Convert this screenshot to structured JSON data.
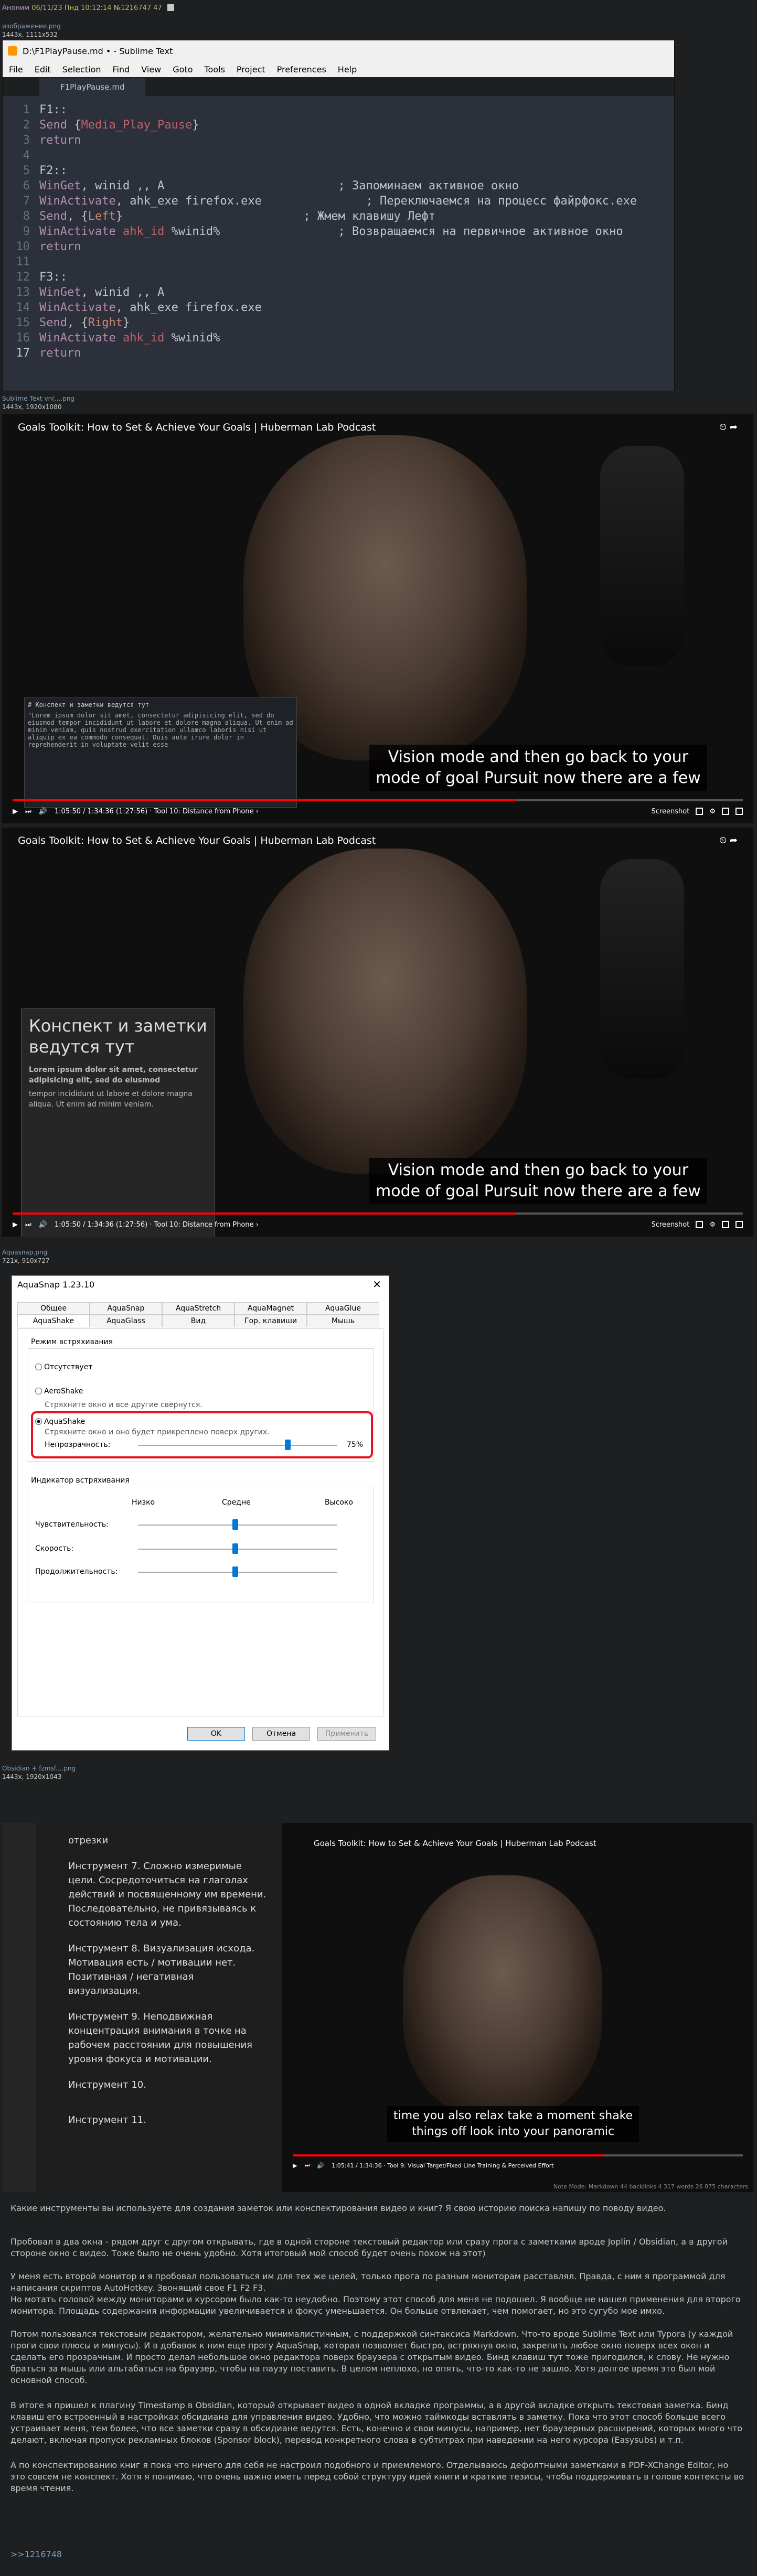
{
  "post": {
    "name": "Аноним",
    "date": "06/11/23 Пнд 10:12:14",
    "num": "№1216747",
    "count": "47"
  },
  "file1": {
    "name": "изображение.png",
    "size": "1443x, 1111x532"
  },
  "sublime": {
    "title": "D:\\F1PlayPause.md • - Sublime Text",
    "menu": [
      "File",
      "Edit",
      "Selection",
      "Find",
      "View",
      "Goto",
      "Tools",
      "Project",
      "Preferences",
      "Help"
    ],
    "tab": "F1PlayPause.md",
    "lines": [
      {
        "n": "1",
        "t": [
          [
            "c-lbl",
            "F1::"
          ]
        ]
      },
      {
        "n": "2",
        "t": [
          [
            "c-kw",
            "Send "
          ],
          [
            "c-pl",
            "{"
          ],
          [
            "c-vr",
            "Media_Play_Pause"
          ],
          [
            "c-pl",
            "}"
          ]
        ]
      },
      {
        "n": "3",
        "t": [
          [
            "c-kw",
            "return"
          ]
        ]
      },
      {
        "n": "4",
        "t": []
      },
      {
        "n": "5",
        "t": [
          [
            "c-lbl",
            "F2::"
          ]
        ]
      },
      {
        "n": "6",
        "t": [
          [
            "c-kw",
            "WinGet"
          ],
          [
            "c-pl",
            ", winid ,, A                         ; Запоминаем активное окно"
          ]
        ]
      },
      {
        "n": "7",
        "t": [
          [
            "c-kw",
            "WinActivate"
          ],
          [
            "c-pl",
            ", ahk_exe firefox.exe               ; Переключаемся на процесс файрфокс.exe"
          ]
        ]
      },
      {
        "n": "8",
        "t": [
          [
            "c-kw",
            "Send"
          ],
          [
            "c-pl",
            ", {"
          ],
          [
            "c-str",
            "Left"
          ],
          [
            "c-pl",
            "}                          ; Жмем клавишу Лефт"
          ]
        ]
      },
      {
        "n": "9",
        "t": [
          [
            "c-kw",
            "WinActivate "
          ],
          [
            "c-vr",
            "ahk_id "
          ],
          [
            "c-pl",
            "%winid%                 ; Возвращаемся на первичное активное окно"
          ]
        ]
      },
      {
        "n": "10",
        "t": [
          [
            "c-kw",
            "return"
          ]
        ]
      },
      {
        "n": "11",
        "t": []
      },
      {
        "n": "12",
        "t": [
          [
            "c-lbl",
            "F3::"
          ]
        ]
      },
      {
        "n": "13",
        "t": [
          [
            "c-kw",
            "WinGet"
          ],
          [
            "c-pl",
            ", winid ,, A"
          ]
        ]
      },
      {
        "n": "14",
        "t": [
          [
            "c-kw",
            "WinActivate"
          ],
          [
            "c-pl",
            ", ahk_exe firefox.exe"
          ]
        ]
      },
      {
        "n": "15",
        "t": [
          [
            "c-kw",
            "Send"
          ],
          [
            "c-pl",
            ", {"
          ],
          [
            "c-str",
            "Right"
          ],
          [
            "c-pl",
            "}"
          ]
        ]
      },
      {
        "n": "16",
        "t": [
          [
            "c-kw",
            "WinActivate "
          ],
          [
            "c-vr",
            "ahk_id "
          ],
          [
            "c-pl",
            "%winid%"
          ]
        ]
      },
      {
        "n": "17",
        "t": [
          [
            "c-kw",
            "return"
          ]
        ]
      }
    ]
  },
  "file2": {
    "name": "Sublime Text vn(....png",
    "size": "1443x, 1920x1080"
  },
  "video": {
    "title": "Goals Toolkit: How to Set & Achieve Your Goals | Huberman Lab Podcast",
    "subs1": "Vision mode and then go back to your",
    "subs2": "mode of goal Pursuit now there are a few",
    "time": "1:05:50 / 1:34:36 (1:27:56) · Tool 10: Distance from Phone ›",
    "screenshot": "Screenshot",
    "progress": 0.69
  },
  "note1": {
    "title": "# Конспект и заметки ведутся тут",
    "body": "\"Lorem ipsum dolor sit amet, consectetur adipisicing elit, sed do eiusmod tempor incididunt ut labore et dolore magna aliqua. Ut enim ad minim veniam, quis nostrud exercitation ullamco laboris nisi ut aliquip ex ea commodo consequat. Duis aute irure dolor in reprehenderit in voluptate velit esse"
  },
  "note2": {
    "heading": "Конспект и заметки ведутся тут",
    "bold": "Lorem ipsum dolor sit amet, consectetur adipisicing elit, sed do eiusmod",
    "body": "tempor incididunt ut labore et dolore magna aliqua. Ut enim ad minim veniam."
  },
  "file3": {
    "name": "Aquasnap.png",
    "size": "721x, 910x727"
  },
  "aqua": {
    "title": "AquaSnap 1.23.10",
    "tabs1": [
      "Общее",
      "AquaSnap",
      "AquaStretch",
      "AquaMagnet",
      "AquaGlue"
    ],
    "tabs2": [
      "AquaShake",
      "AquaGlass",
      "Вид",
      "Гор. клавиши",
      "Мышь"
    ],
    "mode_label": "Режим встряхивания",
    "opt_off": "Отсутствует",
    "opt_aero": "AeroShake",
    "aero_desc": "Стряхните окно и все другие свернутся.",
    "opt_aqua": "AquaShake",
    "aqua_desc": "Стряхните окно и оно будет прикреплено поверх других.",
    "opacity_label": "Непрозрачность:",
    "opacity_val": "75%",
    "ind_label": "Индикатор встряхивания",
    "low": "Низко",
    "mid": "Средне",
    "high": "Высоко",
    "sens": "Чувствительность:",
    "speed": "Скорость:",
    "dur": "Продолжительность:",
    "ok": "OK",
    "cancel": "Отмена",
    "apply": "Применить"
  },
  "file4": {
    "name": "Obsidian + fzmsf....png",
    "size": "1443x, 1920x1043"
  },
  "obs": {
    "p0": "отрезки",
    "p1": "Инструмент 7. Сложно измеримые цели. Сосредоточиться на глаголах действий и посвященному им времени. Последовательно, не привязываясь к состоянию тела и ума.",
    "p2": "Инструмент 8. Визуализация исхода. Мотивация есть / мотивации нет. Позитивная / негативная визуализация.",
    "p3": "Инструмент 9. Неподвижная концентрация внимания в точке на рабочем расстоянии для повышения уровня фокуса и мотивации.",
    "p4": "Инструмент 10.",
    "p5": "Инструмент 11.",
    "subs1": "time you also relax take a moment shake",
    "subs2": "things off look into your panoramic",
    "time": "1:05:41 / 1:34:36 · Tool 9: Visual Target/Fixed Line Training & Perceived Effort",
    "status": "Note Mode: Markdown   44 backlinks   4 317 words   26 875 characters"
  },
  "text": {
    "q": "Какие инструменты вы используете для создания заметок или конспектирования видео и книг? Я свою историю поиска напишу по поводу видео.",
    "p1": "Пробовал в два окна - рядом друг с другом открывать, где в одной стороне текстовый редактор или сразу прога с заметками вроде Joplin / Obsidian, а в другой стороне окно с видео. Тоже было не очень удобно. Хотя итоговый мой способ будет очень похож на этот)",
    "p2": "У меня есть второй монитор и я пробовал пользоваться им для тех же целей, только прога по разным мониторам расставлял. Правда, с ним я программой для написания скриптов AutoHotkey. Звонящий свое F1 F2 F3.",
    "p3": "Но мотать головой между мониторами и курсором было как-то неудобно. Поэтому этот способ для меня не подошел. Я вообще не нашел применения для второго монитора. Площадь содержания информации увеличивается и фокус уменьшается. Он больше отвлекает, чем помогает, но это сугубо мое имхо.",
    "p4": "Потом пользовался текстовым редактором, желательно минималистичным, с поддержкой синтаксиса Markdown. Что-то вроде Sublime Text или Typora (у каждой проги свои плюсы и минусы). И в добавок к ним еще прогу AquaSnap, которая позволяет быстро, встряхнув окно, закрепить любое окно поверх всех окон и сделать его прозрачным. И просто делал небольшое окно редактора поверх браузера с открытым видео. Бинд клавиш тут тоже пригодился, к слову. Не нужно браться за мышь или альтабаться на браузер, чтобы на паузу поставить. В целом неплохо, но опять, что-то как-то не зашло. Хотя долгое время это был мой основной способ.",
    "p5": "В итоге я пришел к плагину Timestamp в Obsidian, который открывает видео в одной вкладке программы, а в другой вкладке открыть текстовая заметка. Бинд клавиш его встроенный в настройках обсидиана для управления видео. Удобно, что можно таймкоды вставлять в заметку. Пока что этот способ больше всего устраивает меня, тем более, что все заметки сразу в обсидиане ведутся. Есть, конечно и свои минусы, например, нет браузерных расширений, которых много что делают, включая пропуск рекламных блоков (Sponsor block), перевод конкретного слова в субтитрах при наведении на него курсора (Easysubs) и т.п.",
    "p6": "А по конспектированию книг я пока что ничего для себя не настроил подобного и приемлемого. Отделываюсь дефолтными заметками в PDF-XChange Editor, но это совсем не конспект. Хотя я понимаю, что очень важно иметь перед собой структуру идей книги и краткие тезисы, чтобы поддерживать в голове контексты во время чтения.",
    "reply": ">>1216748"
  },
  "colors": {
    "bg": "#1d1f21",
    "accent": "#ff0000",
    "highlight": "#e81123"
  }
}
